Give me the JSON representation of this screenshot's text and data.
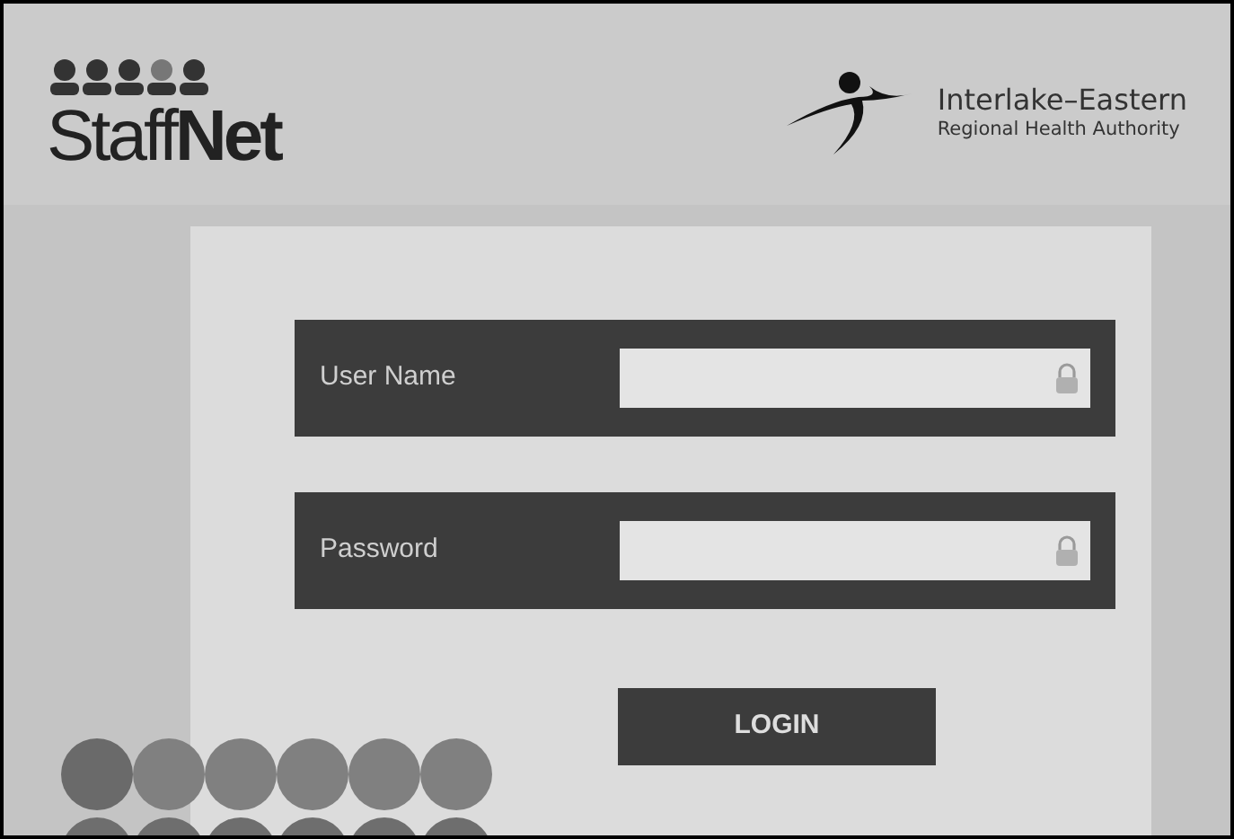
{
  "header": {
    "logo_text": "Staff**Net**",
    "org_name": "Interlake–Eastern",
    "org_subtitle": "Regional Health Authority"
  },
  "form": {
    "fields": [
      {
        "label": "User Name"
      },
      {
        "label": "Password"
      }
    ],
    "button": "LOGIN"
  }
}
